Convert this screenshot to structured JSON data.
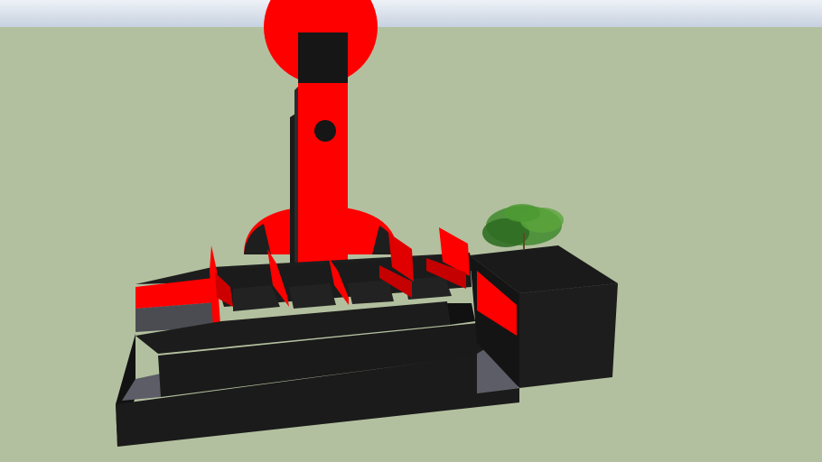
{
  "scene": {
    "colors": {
      "sky_top": "#e7ecf3",
      "sky_bottom": "#c9d3e2",
      "ground": "#b3c09f",
      "accent_red": "#ff0000",
      "dark_red": "#d30000",
      "black": "#161616",
      "face_dark": "#1f1f1f",
      "face_mid": "#262626",
      "floor_gray": "#5c5d67",
      "tree_green": "#3f8a2e"
    },
    "objects": [
      "red-circle-sign",
      "red-tower",
      "red-half-dome",
      "black-platform-base",
      "red-seat-panels",
      "black-cube-block",
      "tree"
    ]
  }
}
